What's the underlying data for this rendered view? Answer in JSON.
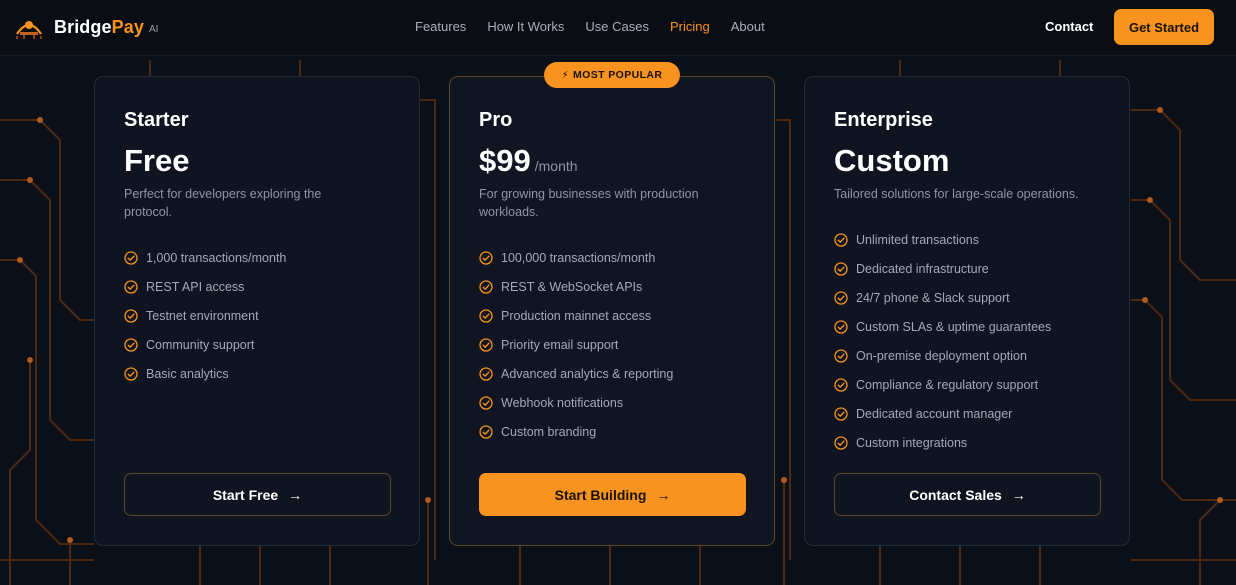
{
  "brand": {
    "name_part1": "Bridge",
    "name_part2": "Pay",
    "suffix": "AI",
    "accent_color": "#f7931e"
  },
  "nav": {
    "links": [
      {
        "label": "Features"
      },
      {
        "label": "How It Works"
      },
      {
        "label": "Use Cases"
      },
      {
        "label": "Pricing",
        "active": true
      },
      {
        "label": "About"
      }
    ],
    "contact_label": "Contact",
    "cta_label": "Get Started"
  },
  "pricing": {
    "badge_label": "MOST POPULAR",
    "badge_icon": "lightning-icon",
    "plans": [
      {
        "name": "Starter",
        "price": "Free",
        "period": "",
        "description": "Perfect for developers exploring the protocol.",
        "features": [
          "1,000 transactions/month",
          "REST API access",
          "Testnet environment",
          "Community support",
          "Basic analytics"
        ],
        "button_label": "Start Free",
        "button_style": "outline"
      },
      {
        "name": "Pro",
        "price": "$99",
        "period": "/month",
        "description": "For growing businesses with production workloads.",
        "features": [
          "100,000 transactions/month",
          "REST & WebSocket APIs",
          "Production mainnet access",
          "Priority email support",
          "Advanced analytics & reporting",
          "Webhook notifications",
          "Custom branding"
        ],
        "button_label": "Start Building",
        "button_style": "solid"
      },
      {
        "name": "Enterprise",
        "price": "Custom",
        "period": "",
        "description": "Tailored solutions for large-scale operations.",
        "features": [
          "Unlimited transactions",
          "Dedicated infrastructure",
          "24/7 phone & Slack support",
          "Custom SLAs & uptime guarantees",
          "On-premise deployment option",
          "Compliance & regulatory support",
          "Dedicated account manager",
          "Custom integrations"
        ],
        "button_label": "Contact Sales",
        "button_style": "outline"
      }
    ]
  },
  "icons": {
    "check": "check-circle-icon",
    "arrow": "arrow-right-icon"
  }
}
